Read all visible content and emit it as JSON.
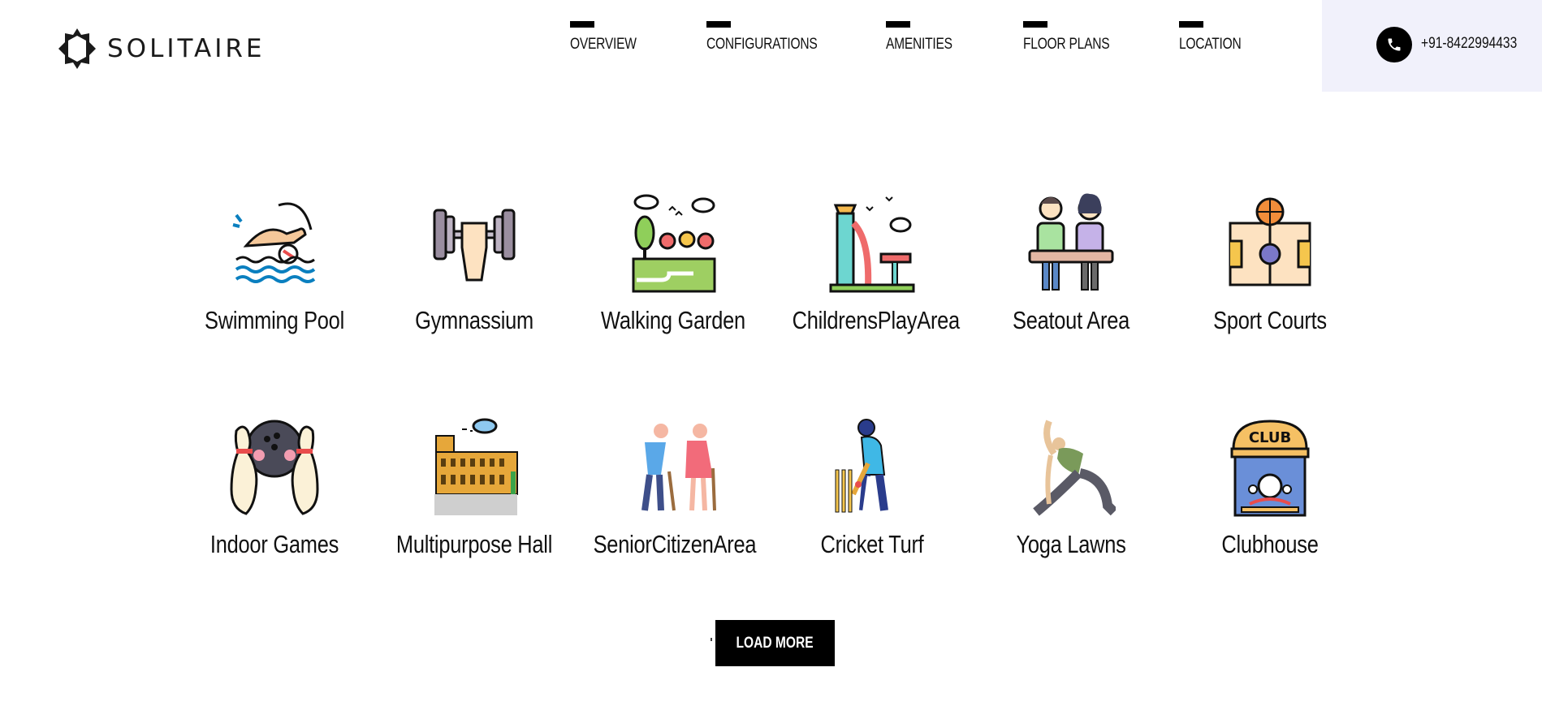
{
  "header": {
    "brand": "SOLITAIRE",
    "nav": [
      {
        "label": "OVERVIEW"
      },
      {
        "label": "CONFIGURATIONS"
      },
      {
        "label": "AMENITIES"
      },
      {
        "label": "FLOOR PLANS"
      },
      {
        "label": "LOCATION"
      }
    ],
    "phone": "+91-8422994433"
  },
  "amenities": [
    {
      "label": "Swimming Pool",
      "icon": "swimming-icon"
    },
    {
      "label": "Gymnassium",
      "icon": "dumbbell-icon"
    },
    {
      "label": "Walking Garden",
      "icon": "garden-icon"
    },
    {
      "label": "ChildrensPlayArea",
      "icon": "playground-icon"
    },
    {
      "label": "Seatout Area",
      "icon": "bench-couple-icon"
    },
    {
      "label": "Sport Courts",
      "icon": "basketball-court-icon"
    },
    {
      "label": "Indoor Games",
      "icon": "bowling-icon"
    },
    {
      "label": "Multipurpose Hall",
      "icon": "colosseum-icon"
    },
    {
      "label": "SeniorCitizenArea",
      "icon": "elderly-couple-icon"
    },
    {
      "label": "Cricket Turf",
      "icon": "cricket-icon"
    },
    {
      "label": "Yoga Lawns",
      "icon": "yoga-icon"
    },
    {
      "label": "Clubhouse",
      "icon": "club-icon"
    }
  ],
  "load_more_label": "LOAD MORE",
  "colors": {
    "accent": "#000000",
    "contact_bg": "#f1f1fb"
  }
}
